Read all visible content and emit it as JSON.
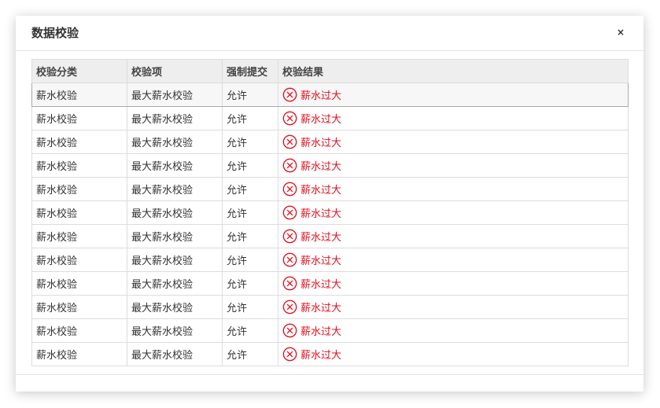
{
  "dialog": {
    "title": "数据校验",
    "close_label": "×"
  },
  "table": {
    "columns": [
      "校验分类",
      "校验项",
      "强制提交",
      "校验结果"
    ],
    "rows": [
      {
        "category": "薪水校验",
        "item": "最大薪水校验",
        "force": "允许",
        "result": "薪水过大"
      },
      {
        "category": "薪水校验",
        "item": "最大薪水校验",
        "force": "允许",
        "result": "薪水过大"
      },
      {
        "category": "薪水校验",
        "item": "最大薪水校验",
        "force": "允许",
        "result": "薪水过大"
      },
      {
        "category": "薪水校验",
        "item": "最大薪水校验",
        "force": "允许",
        "result": "薪水过大"
      },
      {
        "category": "薪水校验",
        "item": "最大薪水校验",
        "force": "允许",
        "result": "薪水过大"
      },
      {
        "category": "薪水校验",
        "item": "最大薪水校验",
        "force": "允许",
        "result": "薪水过大"
      },
      {
        "category": "薪水校验",
        "item": "最大薪水校验",
        "force": "允许",
        "result": "薪水过大"
      },
      {
        "category": "薪水校验",
        "item": "最大薪水校验",
        "force": "允许",
        "result": "薪水过大"
      },
      {
        "category": "薪水校验",
        "item": "最大薪水校验",
        "force": "允许",
        "result": "薪水过大"
      },
      {
        "category": "薪水校验",
        "item": "最大薪水校验",
        "force": "允许",
        "result": "薪水过大"
      },
      {
        "category": "薪水校验",
        "item": "最大薪水校验",
        "force": "允许",
        "result": "薪水过大"
      },
      {
        "category": "薪水校验",
        "item": "最大薪水校验",
        "force": "允许",
        "result": "薪水过大"
      }
    ],
    "selected_row": 0,
    "error_icon": "circle-x-icon"
  },
  "colors": {
    "error": "#e0111e",
    "header_bg": "#eeeeee",
    "selected_row_bg": "#f7f7f7"
  }
}
